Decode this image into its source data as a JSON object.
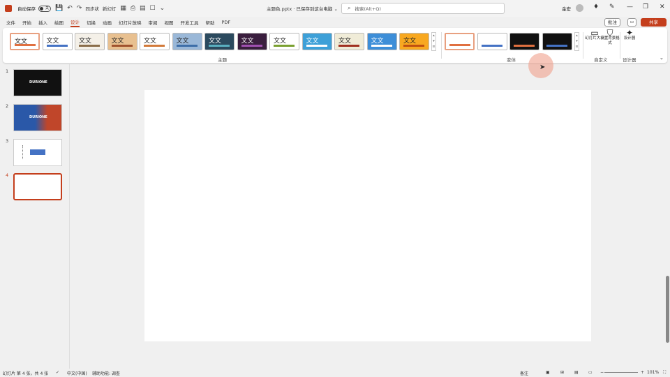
{
  "titlebar": {
    "autosave_label": "自动保存",
    "autosave_state": "关",
    "quick_access_1": "同步状",
    "quick_access_2": "新幻灯",
    "doc_title": "主题色.pptx · 已保存到这台电脑 ⌄",
    "search_placeholder": "搜索(Alt+Q)",
    "user_name": "金宏"
  },
  "menu": {
    "tabs": [
      "文件",
      "开始",
      "插入",
      "绘图",
      "设计",
      "切换",
      "动画",
      "幻灯片放映",
      "审阅",
      "视图",
      "开发工具",
      "帮助",
      "PDF"
    ],
    "active_tab": "设计",
    "comment_label": "批注",
    "share_label": "共享"
  },
  "ribbon": {
    "theme_sample_text": "文文",
    "themes_group_label": "主题",
    "variants_group_label": "变体",
    "customize_group_label": "自定义",
    "designer_group_label": "设计器",
    "slide_size_label": "幻灯片大小",
    "format_bg_label": "设置背景格式",
    "designer_label": "设计器",
    "theme_colors": [
      {
        "bg": "#ffffff",
        "swatch": "#e07040"
      },
      {
        "bg": "#ffffff",
        "swatch": "#4472c4"
      },
      {
        "bg": "#f4f0e8",
        "swatch": "#8a6d4a"
      },
      {
        "bg": "#e8c090",
        "swatch": "#a0522d"
      },
      {
        "bg": "#ffffff",
        "swatch": "#d27a3a"
      },
      {
        "bg": "#9ab8d8",
        "swatch": "#3d6ea8"
      },
      {
        "bg": "#2b4a5e",
        "swatch": "#5ab0c0"
      },
      {
        "bg": "#3a1e3e",
        "swatch": "#a050b0"
      },
      {
        "bg": "#ffffff",
        "swatch": "#7aa030"
      },
      {
        "bg": "#3da0d8",
        "swatch": "#ffffff"
      },
      {
        "bg": "#f0ecd8",
        "swatch": "#a03020"
      },
      {
        "bg": "#3d8ed8",
        "swatch": "#ffffff"
      },
      {
        "bg": "#f8a820",
        "swatch": "#c05010"
      }
    ],
    "variants": [
      {
        "bg": "#ffffff",
        "swatch": "#e07040"
      },
      {
        "bg": "#ffffff",
        "swatch": "#4472c4"
      },
      {
        "bg": "#111111",
        "swatch": "#e07040"
      },
      {
        "bg": "#111111",
        "swatch": "#4472c4"
      }
    ]
  },
  "slides": {
    "numbers": [
      "1",
      "2",
      "3",
      "4"
    ],
    "slide1_text": "DURIONE",
    "slide2_text": "DURIONE"
  },
  "status": {
    "slide_info": "幻灯片 第 4 张，共 4 张",
    "language": "中文(中国)",
    "accessibility": "辅助功能: 调查",
    "notes": "备注",
    "zoom": "101%"
  }
}
